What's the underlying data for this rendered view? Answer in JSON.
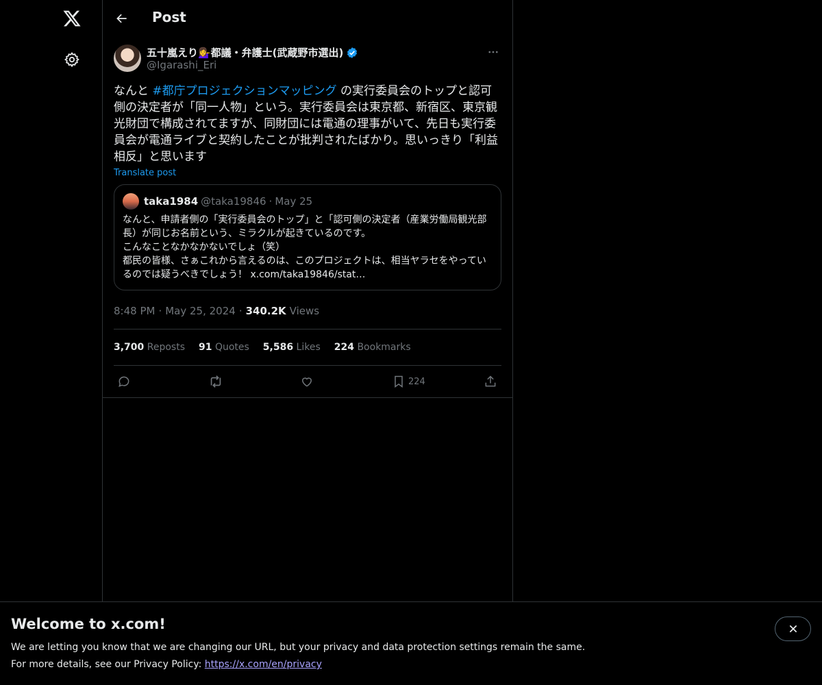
{
  "header": {
    "title": "Post"
  },
  "post": {
    "author_name": "五十嵐えり💁‍♀️都議・弁護士(武蔵野市選出)",
    "author_handle": "@Igarashi_Eri",
    "text_before": "なんと ",
    "hashtag": "#都庁プロジェクションマッピング",
    "text_after": " の実行委員会のトップと認可側の決定者が「同一人物」という。実行委員会は東京都、新宿区、東京観光財団で構成されてますが、同財団には電通の理事がいて、先日も実行委員会が電通ライブと契約したことが批判されたばかり。思いっきり「利益相反」と思います",
    "translate_label": "Translate post",
    "time": "8:48 PM",
    "date": "May 25, 2024",
    "views_count": "340.2K",
    "views_label": "Views"
  },
  "quote": {
    "name": "taka1984",
    "handle": "@taka19846",
    "date": "May 25",
    "text": "なんと、申請者側の「実行委員会のトップ」と「認可側の決定者（産業労働局観光部長）が同じお名前という、ミラクルが起きているのです。\nこんなことなかなかないでしょ（笑）\n都民の皆様、さぁこれから言えるのは、このプロジェクトは、相当ヤラセをやっているのでは疑うべきでしょう！ x.com/taka19846/stat…"
  },
  "stats": {
    "reposts_count": "3,700",
    "reposts_label": "Reposts",
    "quotes_count": "91",
    "quotes_label": "Quotes",
    "likes_count": "5,586",
    "likes_label": "Likes",
    "bookmarks_count": "224",
    "bookmarks_label": "Bookmarks"
  },
  "actions": {
    "bookmark_count": "224"
  },
  "banner": {
    "title": "Welcome to x.com!",
    "line1": "We are letting you know that we are changing our URL, but your privacy and data protection settings remain the same.",
    "line2_prefix": "For more details, see our Privacy Policy: ",
    "link": "https://x.com/en/privacy"
  },
  "icons": {
    "logo": "x-logo-icon",
    "settings": "gear-icon",
    "back": "arrow-left-icon",
    "verified": "verified-badge-icon",
    "more": "more-horizontal-icon",
    "reply": "reply-icon",
    "repost": "repost-icon",
    "like": "heart-icon",
    "bookmark": "bookmark-icon",
    "share": "share-icon",
    "close": "close-icon"
  },
  "colors": {
    "accent": "#1d9bf0",
    "background": "#000000",
    "text": "#e7e9ea",
    "muted": "#71767b",
    "border": "#2f3336",
    "link_visited": "#a9a3ff"
  }
}
